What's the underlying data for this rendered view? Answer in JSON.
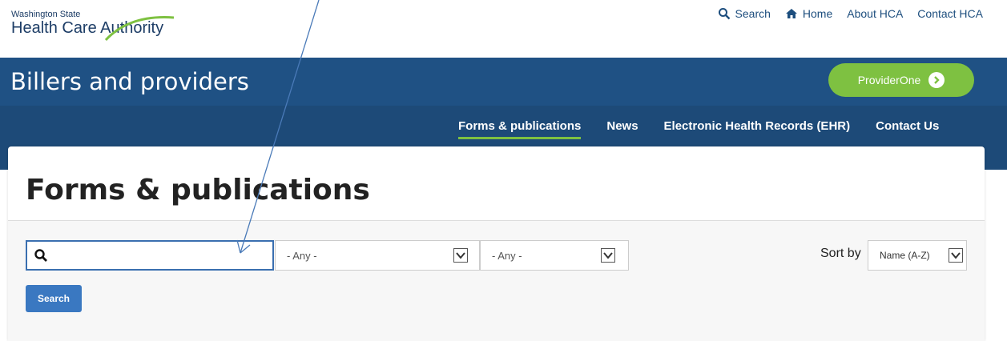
{
  "logo": {
    "line1": "Washington State",
    "line2": "Health Care Authority"
  },
  "utility_nav": {
    "search": "Search",
    "home": "Home",
    "about": "About HCA",
    "contact": "Contact HCA"
  },
  "header": {
    "section_title": "Billers and providers",
    "provider_button": "ProviderOne"
  },
  "main_nav": [
    {
      "label": "Forms & publications",
      "active": true
    },
    {
      "label": "News",
      "active": false
    },
    {
      "label": "Electronic Health Records (EHR)",
      "active": false
    },
    {
      "label": "Contact Us",
      "active": false
    }
  ],
  "page": {
    "title": "Forms & publications"
  },
  "filters": {
    "search_value": "",
    "select_1": "- Any -",
    "select_2": "- Any -",
    "sort_label": "Sort by",
    "sort_value": "Name (A-Z)",
    "search_button": "Search"
  },
  "colors": {
    "header_blue": "#1f5184",
    "nav_blue": "#1d4a78",
    "accent_green": "#7ec141",
    "button_blue": "#3a78c1",
    "annotation_arrow": "#4a7ab8"
  },
  "icons": [
    "search-icon",
    "home-icon",
    "arrow-right-circle-icon",
    "chevron-down-icon"
  ]
}
